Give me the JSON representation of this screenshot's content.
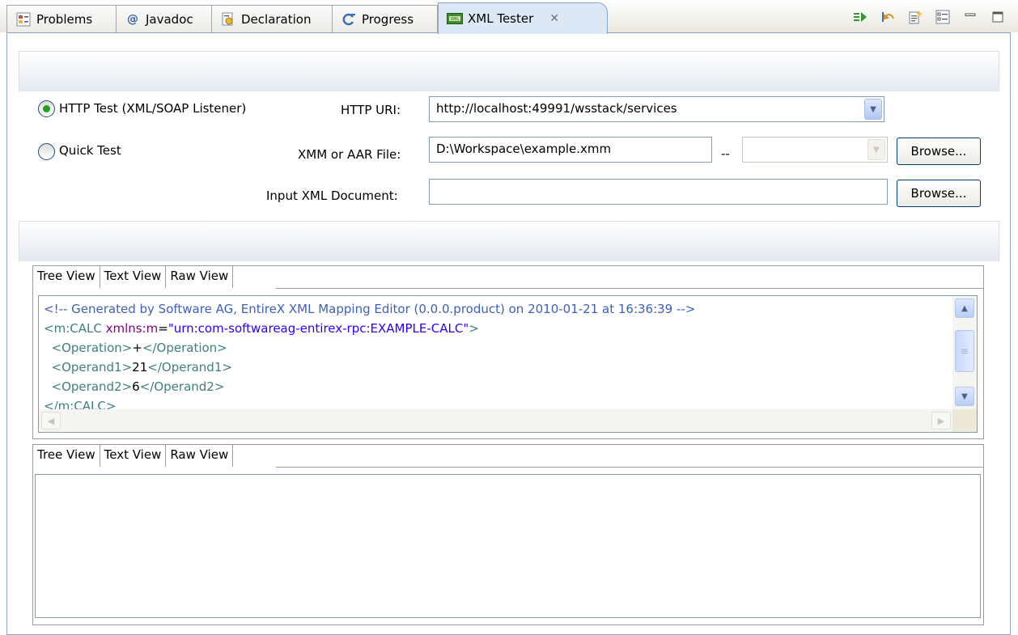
{
  "tabs": [
    {
      "label": "Problems",
      "icon": "problems-icon"
    },
    {
      "label": "Javadoc",
      "icon": "at-icon"
    },
    {
      "label": "Declaration",
      "icon": "declaration-icon"
    },
    {
      "label": "Progress",
      "icon": "progress-icon"
    },
    {
      "label": "XML Tester",
      "icon": "xml-tester-icon",
      "active": true
    }
  ],
  "toolbar": {
    "icons": [
      "run-icon",
      "reset-icon",
      "new-file-icon",
      "view-list-icon",
      "minimize-icon",
      "maximize-icon"
    ]
  },
  "form": {
    "radio_http": "HTTP Test (XML/SOAP Listener)",
    "radio_quick": "Quick Test",
    "http_uri_label": "HTTP URI:",
    "http_uri_value": "http://localhost:49991/wsstack/services",
    "xmm_label": "XMM or AAR File:",
    "xmm_value": "D:\\Workspace\\example.xmm",
    "xmm_sep": "--",
    "input_xml_label": "Input XML Document:",
    "input_xml_value": "",
    "browse_label": "Browse..."
  },
  "view_tabs": [
    "Tree View",
    "Text View",
    "Raw View"
  ],
  "request_xml": {
    "comment": "<!-- Generated by Software AG, EntireX XML Mapping Editor (0.0.0.product) on 2010-01-21 at 16:36:39 -->",
    "line2_tag": "<m:CALC ",
    "line2_attr": "xmlns:m",
    "line2_eq": "=",
    "line2_val": "\"urn:com-softwareag-entirex-rpc:EXAMPLE-CALC\"",
    "line2_end": ">",
    "op_open": "  <Operation>",
    "op_val": "+",
    "op_close": "</Operation>",
    "o1_open": "  <Operand1>",
    "o1_val": "21",
    "o1_close": "</Operand1>",
    "o2_open": "  <Operand2>",
    "o2_val": "6",
    "o2_close": "</Operand2>",
    "close": "</m:CALC>"
  },
  "colors": {
    "accent_green": "#21a121",
    "panel_border": "#8aa4c9"
  }
}
